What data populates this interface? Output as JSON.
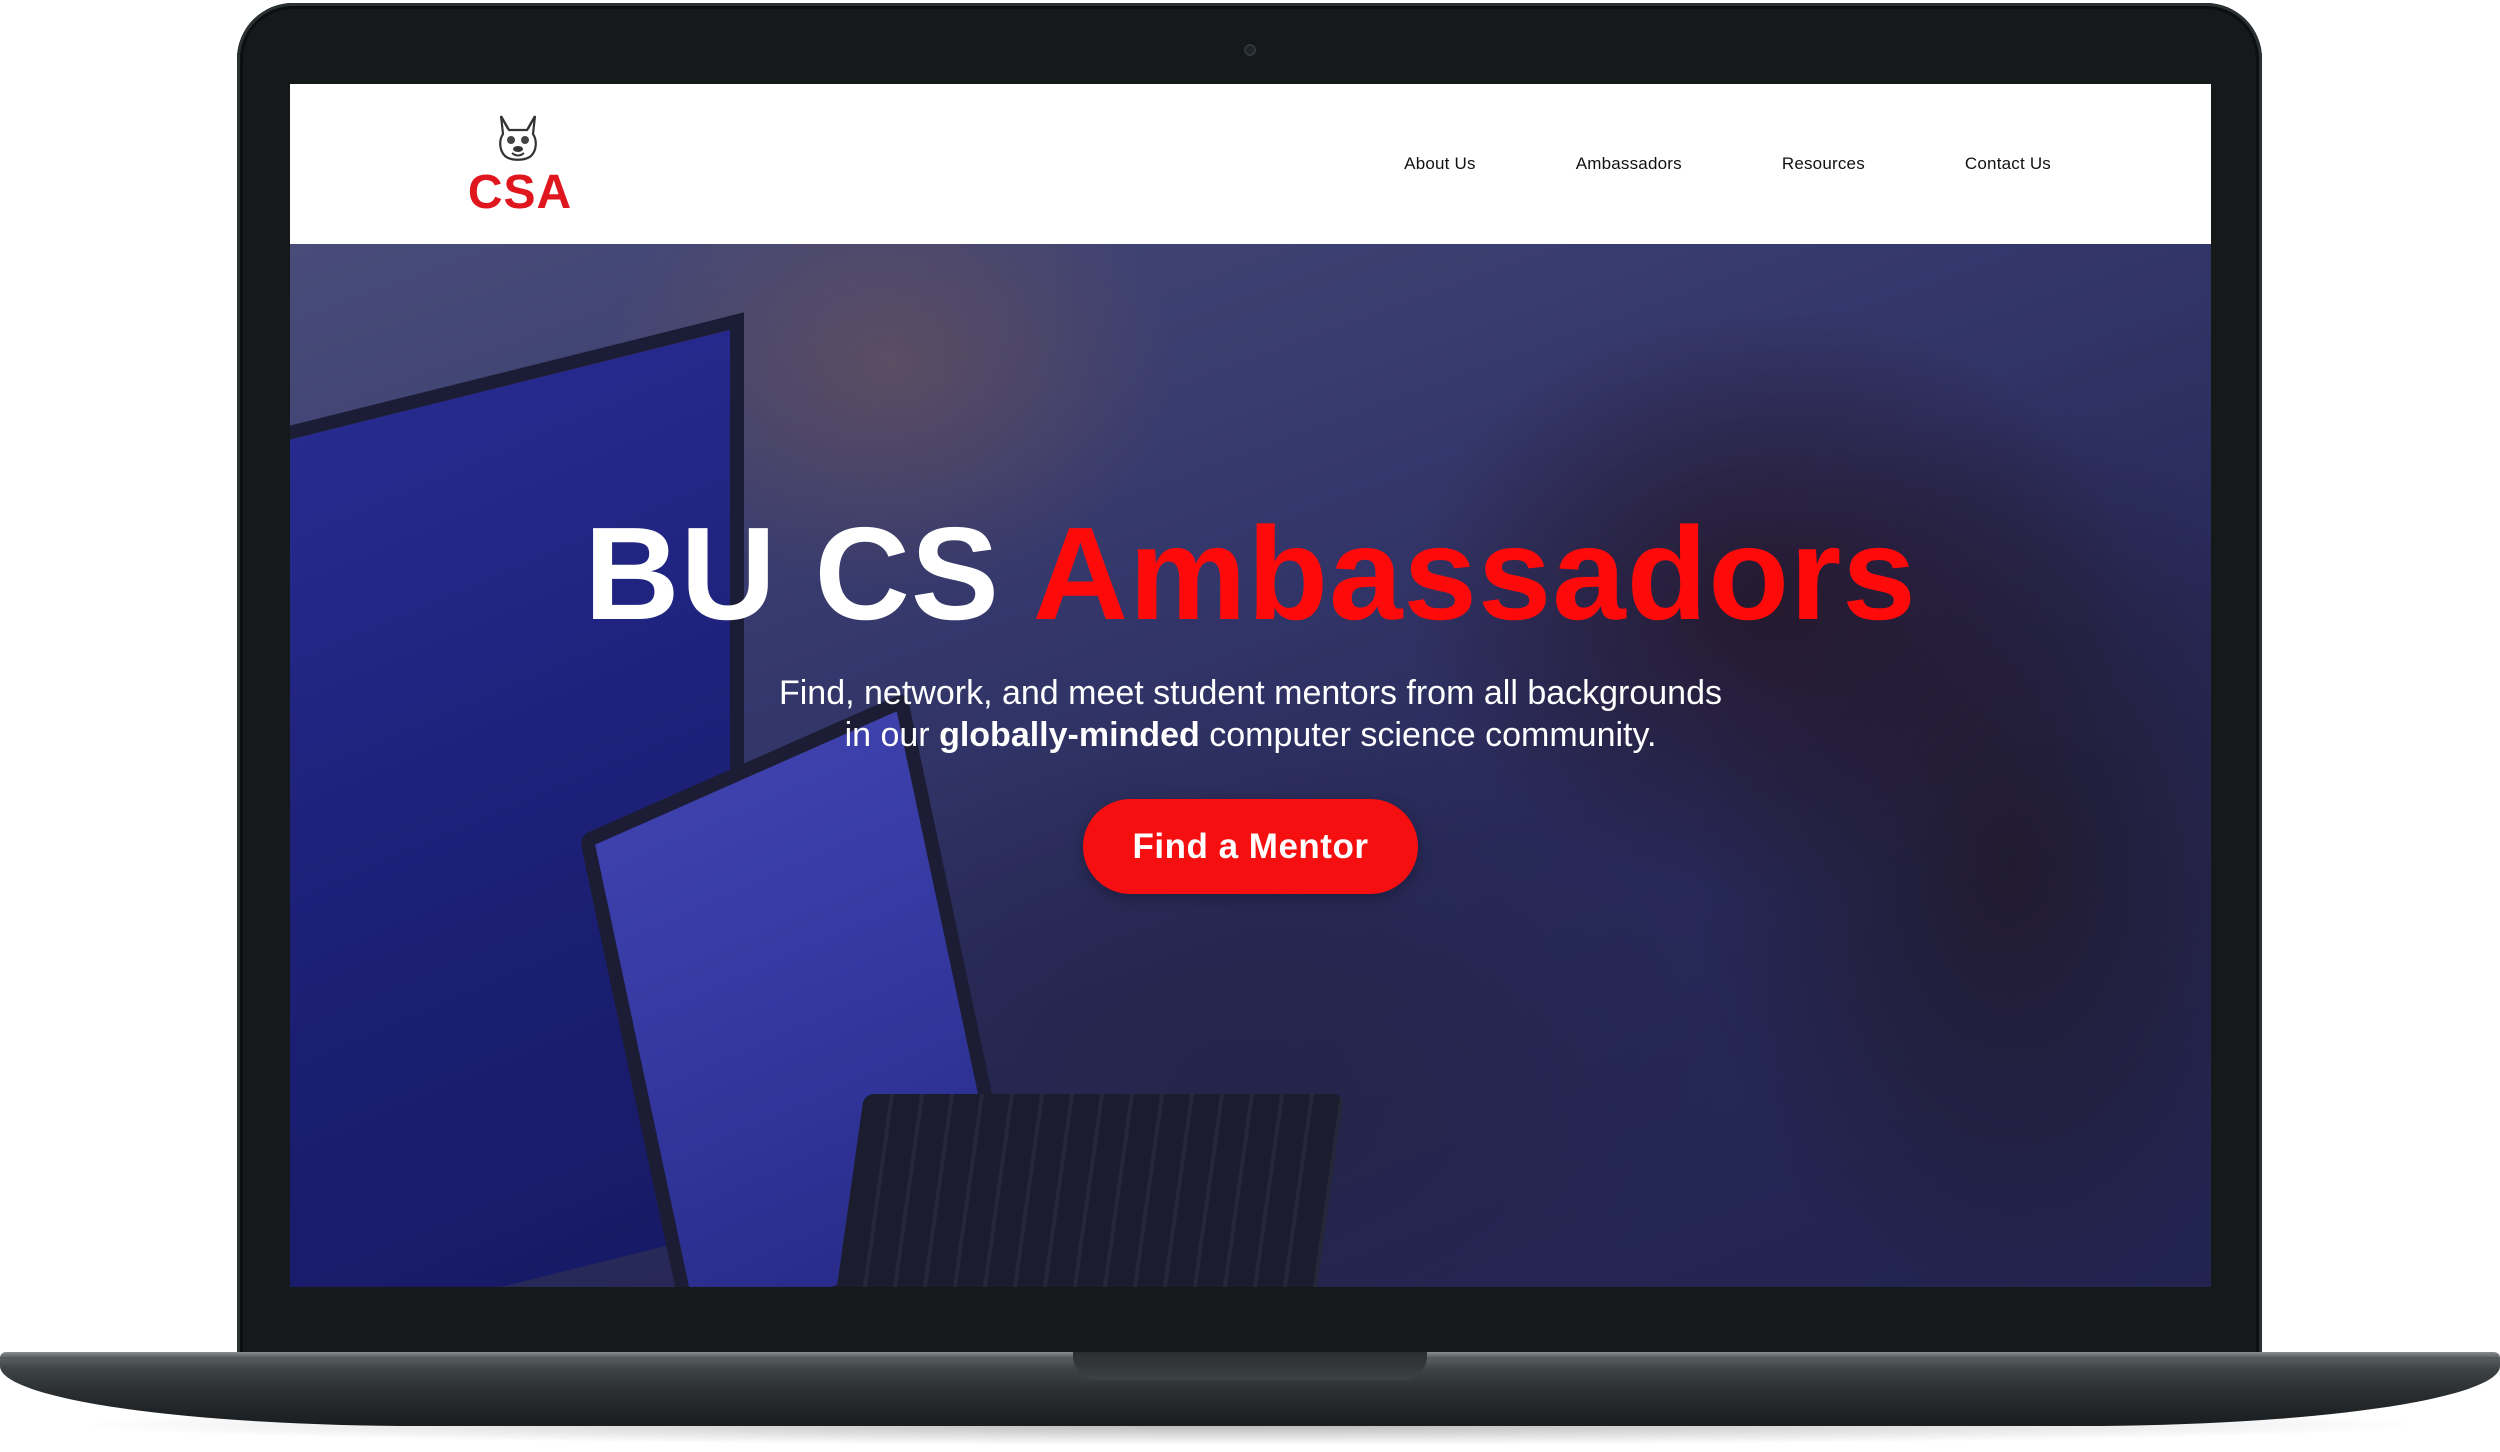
{
  "brand": {
    "logo_text": "CSA",
    "logo_icon": "french-bulldog-icon",
    "accent_color": "#e0161f"
  },
  "nav": {
    "links": [
      {
        "label": "About Us"
      },
      {
        "label": "Ambassadors"
      },
      {
        "label": "Resources"
      },
      {
        "label": "Contact Us"
      }
    ]
  },
  "hero": {
    "title_white": "BU CS ",
    "title_red": "Ambassadors",
    "subtitle_line1": "Find, network, and meet student mentors from all backgrounds",
    "subtitle_line2_pre": "in our ",
    "subtitle_line2_bold": "globally-minded",
    "subtitle_line2_post": " computer science community.",
    "cta_label": "Find a Mentor",
    "cta_color": "#f50f10",
    "title_red_color": "#ff0a0a"
  }
}
